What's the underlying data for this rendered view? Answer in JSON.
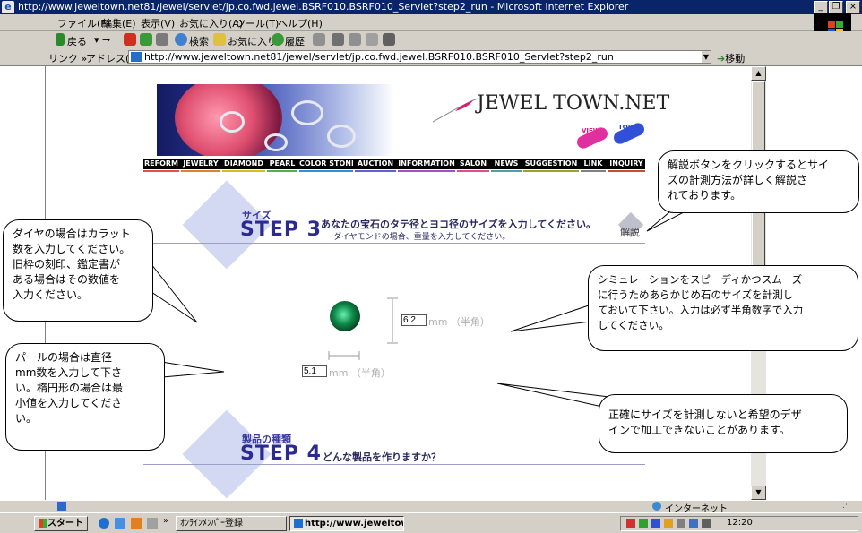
{
  "window": {
    "title": "http://www.jeweltown.net81/jewel/servlet/jp.co.fwd.jewel.BSRF010.BSRF010_Servlet?step2_run - Microsoft Internet Explorer",
    "minimize": "_",
    "restore": "❐",
    "close": "×"
  },
  "menu": [
    "ファイル(F)",
    "編集(E)",
    "表示(V)",
    "お気に入り(A)",
    "ツール(T)",
    "ヘルプ(H)"
  ],
  "toolbar": {
    "back": "戻る",
    "search": "検索",
    "favorites": "お気に入り",
    "history": "履歴"
  },
  "address": {
    "links_label": "リンク »",
    "label": "アドレス(D)",
    "url": "http://www.jeweltown.net81/jewel/servlet/jp.co.fwd.jewel.BSRF010.BSRF010_Servlet?step2_run",
    "go": "移動"
  },
  "site": {
    "logo": "JEWEL TOWN.NET",
    "view": "VIEW",
    "top": "TOP",
    "nav": [
      "REFORM",
      "JEWELRY",
      "DIAMOND",
      "PEARL",
      "COLOR STONE",
      "AUCTION",
      "INFORMATION",
      "SALON",
      "NEWS",
      "SUGGESTION",
      "LINK",
      "INQUIRY"
    ],
    "nav_colors": [
      "#e05050",
      "#e08030",
      "#d0c020",
      "#50b050",
      "#3090d0",
      "#6060d0",
      "#a050c0",
      "#e05090",
      "#50a0a0",
      "#a0a030",
      "#808080",
      "#c05030"
    ]
  },
  "step3": {
    "small": "サイズ",
    "big": "STEP 3",
    "desc": "あなたの宝石のタテ径とヨコ径のサイズを入力してください。",
    "sub": "ダイヤモンドの場合、重量を入力してください。",
    "explain": "解説"
  },
  "inputs": {
    "vertical_value": "6.2",
    "horizontal_value": "5.1",
    "unit": "mm （半角）"
  },
  "step4": {
    "small": "製品の種類",
    "big": "STEP 4",
    "desc": "どんな製品を作りますか？"
  },
  "callouts": {
    "explain": [
      "解説ボタンをクリックするとサイ",
      "ズの計測方法が詳しく解説さ",
      "れております。"
    ],
    "diamond": [
      "ダイヤの場合はカラット",
      "数を入力してください。",
      "旧枠の刻印、鑑定書が",
      "ある場合はその数値を",
      "入力ください。"
    ],
    "simulation": [
      "シミュレーションをスピーディかつスムーズ",
      "に行うためあらかじめ石のサイズを計測し",
      "ておいて下さい。入力は必ず半角数字で入力",
      "してください。"
    ],
    "pearl": [
      "パールの場合は直径",
      "mm数を入力して下さ",
      "い。楕円形の場合は最",
      "小値を入力してくださ",
      "い。"
    ],
    "accuracy": [
      "正確にサイズを計測しないと希望のデザ",
      "インで加工できないことがあります。"
    ]
  },
  "status": {
    "zone": "インターネット"
  },
  "taskbar": {
    "start": "スタート",
    "task1": "ｵﾝﾗｲﾝﾒﾝﾊﾞｰ登録",
    "task2": "http://www.jeweltow...",
    "clock": "12:20"
  }
}
